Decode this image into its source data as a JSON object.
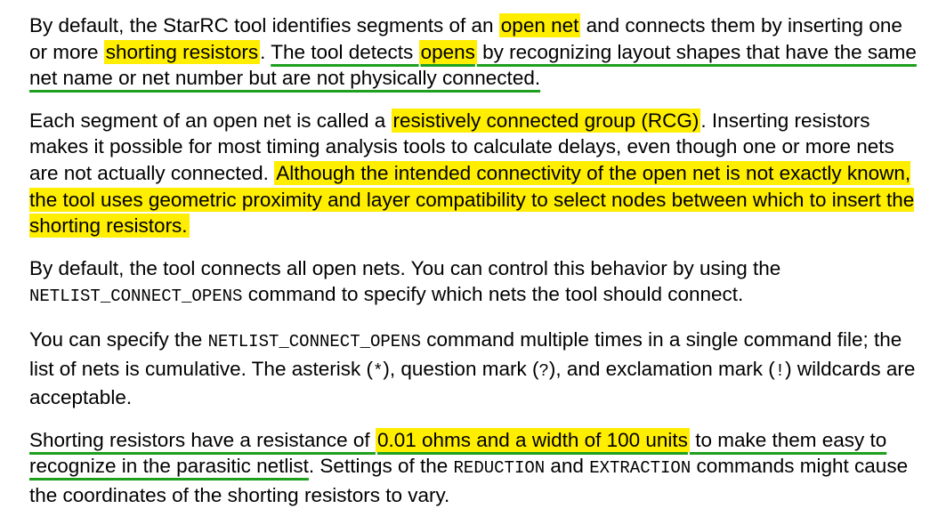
{
  "paragraphs": {
    "p1": {
      "s1": "By default, the StarRC tool identifies segments of an ",
      "h1": "open net",
      "s2": " and connects them by inserting one or more ",
      "h2": "shorting resistors",
      "s3": ". ",
      "u1": "The tool detects ",
      "h3": "opens",
      "u2": " by recognizing layout shapes that have the same net name or net number but are not physically connected."
    },
    "p2": {
      "s1": "Each segment of an open net is called a ",
      "h1": "resistively connected group (RCG)",
      "s2": ". Inserting resistors makes it possible for most timing analysis tools to calculate delays, even though one or more nets are not actually connected. ",
      "h2": "Although the intended connectivity of the open net is not exactly known, the tool uses geometric proximity and layer compatibility to select nodes between which to insert the shorting resistors."
    },
    "p3": {
      "s1": "By default, the tool connects all open nets. You can control this behavior by using the ",
      "code1": "NETLIST_CONNECT_OPENS",
      "s2": " command to specify which nets the tool should connect."
    },
    "p4": {
      "s1": "You can specify the ",
      "code1": "NETLIST_CONNECT_OPENS",
      "s2": " command multiple times in a single command file; the list of nets is cumulative. The asterisk (",
      "code2": "*",
      "s3": "), question mark (",
      "code3": "?",
      "s4": "), and exclamation mark (",
      "code4": "!",
      "s5": ") wildcards are acceptable."
    },
    "p5": {
      "u1": "Shorting resistors have a resistance of ",
      "h1": "0.01 ohms and a width of 100 units",
      "u2": " to make them easy to recognize in the parasitic netlist",
      "s1": ". Settings of the ",
      "code1": "REDUCTION",
      "s2": " and ",
      "code2": "EXTRACTION",
      "s3": " commands might cause the coordinates of the shorting resistors to vary."
    }
  },
  "colors": {
    "highlight": "#ffee00",
    "underline": "#1ea01e"
  }
}
